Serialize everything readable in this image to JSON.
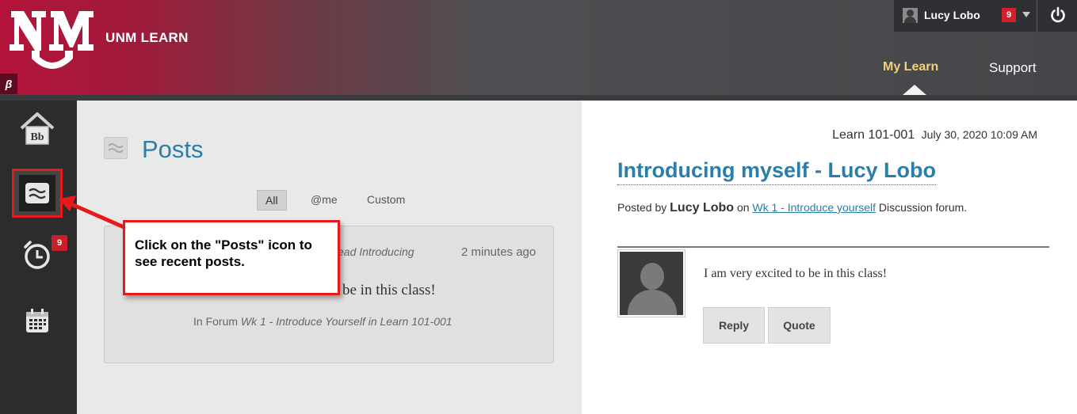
{
  "header": {
    "brand": "UNM LEARN",
    "beta_badge": "β",
    "user_name": "Lucy Lobo",
    "notification_count": "9",
    "nav": {
      "my_learn": "My Learn",
      "support": "Support"
    }
  },
  "rail": {
    "due_badge": "9"
  },
  "posts": {
    "title": "Posts",
    "filters": {
      "all": "All",
      "me": "@me",
      "custom": "Custom"
    },
    "card": {
      "intro_fragment": "ead Introducing",
      "time": "2 minutes ago",
      "body_fragment": "be in this class!",
      "forum_prefix": "In Forum",
      "forum_name": "Wk 1 - Introduce Yourself in Learn 101-001"
    }
  },
  "callout": {
    "text": "Click on the \"Posts\" icon to see recent posts."
  },
  "thread": {
    "course": "Learn 101-001",
    "date": "July 30, 2020 10:09 AM",
    "title": "Introducing myself - Lucy Lobo",
    "posted_by": "Posted by",
    "author": "Lucy Lobo",
    "on": "on",
    "forum_link": "Wk 1 - Introduce yourself",
    "forum_suffix": "Discussion forum.",
    "message": "I am very excited to be in this class!",
    "reply_label": "Reply",
    "quote_label": "Quote"
  },
  "colors": {
    "accent": "#2a7fa8",
    "brand": "#b4143a",
    "callout_border": "#e51b1b"
  }
}
